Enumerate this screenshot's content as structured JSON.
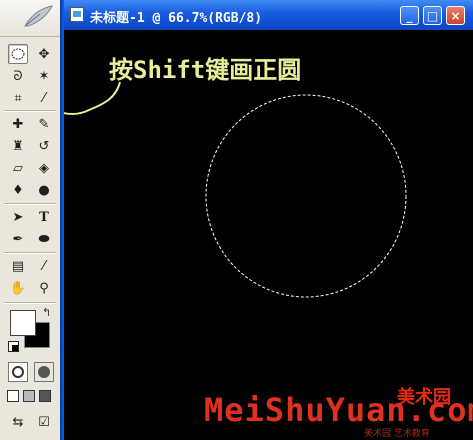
{
  "window": {
    "title": "未标题-1 @ 66.7%(RGB/8)",
    "minimize_label": "_",
    "maximize_label": "□",
    "close_label": "×"
  },
  "canvas": {
    "background_color": "#000000",
    "annotation": "按Shift键画正圆",
    "annotation_color": "#e8ee9a",
    "selection_shape": "circle-marching-ants"
  },
  "watermark": {
    "latin": "MeiShuYuan.com",
    "chinese": "美术园",
    "small_text": "美术园 艺术教育"
  },
  "toolbox": {
    "tools": [
      {
        "name": "elliptical-marquee-tool",
        "glyph": "◯",
        "active": true
      },
      {
        "name": "move-tool",
        "glyph": "✥"
      },
      {
        "name": "lasso-tool",
        "glyph": "ᑫ"
      },
      {
        "name": "magic-wand-tool",
        "glyph": "✶"
      },
      {
        "name": "crop-tool",
        "glyph": "⌗"
      },
      {
        "name": "slice-tool",
        "glyph": "⁄"
      },
      {
        "name": "healing-brush-tool",
        "glyph": "✚"
      },
      {
        "name": "brush-tool",
        "glyph": "✎"
      },
      {
        "name": "clone-stamp-tool",
        "glyph": "♜"
      },
      {
        "name": "history-brush-tool",
        "glyph": "↺"
      },
      {
        "name": "eraser-tool",
        "glyph": "▱"
      },
      {
        "name": "paint-bucket-tool",
        "glyph": "◈"
      },
      {
        "name": "blur-tool",
        "glyph": "∆"
      },
      {
        "name": "dodge-tool",
        "glyph": "●"
      },
      {
        "name": "path-selection-tool",
        "glyph": "➤"
      },
      {
        "name": "type-tool",
        "glyph": "T"
      },
      {
        "name": "pen-tool",
        "glyph": "✒"
      },
      {
        "name": "shape-tool",
        "glyph": "⬬"
      },
      {
        "name": "notes-tool",
        "glyph": "▤"
      },
      {
        "name": "eyedropper-tool",
        "glyph": "∕"
      },
      {
        "name": "hand-tool",
        "glyph": "✋"
      },
      {
        "name": "zoom-tool",
        "glyph": "⚲"
      }
    ],
    "foreground_color": "#ffffff",
    "background_color": "#000000"
  }
}
